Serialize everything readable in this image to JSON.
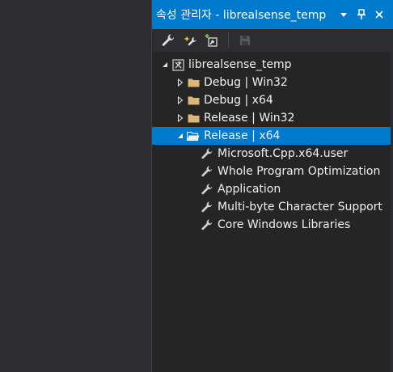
{
  "panel": {
    "title": "속성 관리자 - librealsense_temp",
    "title_buttons": [
      "dropdown-icon",
      "pin-icon",
      "close-icon"
    ]
  },
  "toolbar": {
    "buttons": [
      "properties-icon",
      "add-new-property-sheet-icon",
      "add-existing-property-sheet-icon",
      "save-icon"
    ]
  },
  "tree": {
    "project": "librealsense_temp",
    "configs": [
      {
        "label": "Debug | Win32",
        "expanded": false
      },
      {
        "label": "Debug | x64",
        "expanded": false
      },
      {
        "label": "Release | Win32",
        "expanded": false
      },
      {
        "label": "Release | x64",
        "expanded": true,
        "selected": true
      }
    ],
    "sheets": [
      "Microsoft.Cpp.x64.user",
      "Whole Program Optimization",
      "Application",
      "Multi-byte Character Support",
      "Core Windows Libraries"
    ]
  },
  "colors": {
    "accent": "#007acc",
    "panel_bg": "#252526",
    "outer_bg": "#2d2d30",
    "folder": "#dcb67a"
  }
}
